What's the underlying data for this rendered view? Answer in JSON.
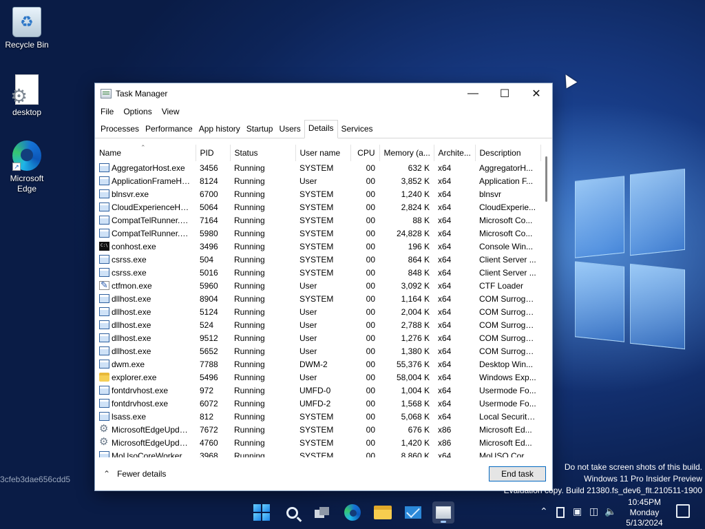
{
  "desktop": {
    "icons": [
      {
        "label": "Recycle Bin"
      },
      {
        "label": "desktop"
      },
      {
        "label": "Microsoft Edge"
      }
    ],
    "hash": "3cfeb3dae656cdd5",
    "watermark": [
      "Do not take screen shots of this build.",
      "Windows 11 Pro Insider Preview",
      "Evaluation copy. Build 21380.fs_dev6_flt.210511-1900"
    ]
  },
  "window": {
    "title": "Task Manager",
    "menu": [
      "File",
      "Options",
      "View"
    ],
    "tabs": [
      "Processes",
      "Performance",
      "App history",
      "Startup",
      "Users",
      "Details",
      "Services"
    ],
    "active_tab": "Details",
    "columns": [
      "Name",
      "PID",
      "Status",
      "User name",
      "CPU",
      "Memory (a...",
      "Archite...",
      "Description"
    ],
    "rows": [
      {
        "icon": "app",
        "name": "AggregatorHost.exe",
        "pid": "3456",
        "status": "Running",
        "user": "SYSTEM",
        "cpu": "00",
        "mem": "632 K",
        "arch": "x64",
        "desc": "AggregatorH..."
      },
      {
        "icon": "app",
        "name": "ApplicationFrameHo...",
        "pid": "8124",
        "status": "Running",
        "user": "User",
        "cpu": "00",
        "mem": "3,852 K",
        "arch": "x64",
        "desc": "Application F..."
      },
      {
        "icon": "app",
        "name": "blnsvr.exe",
        "pid": "6700",
        "status": "Running",
        "user": "SYSTEM",
        "cpu": "00",
        "mem": "1,240 K",
        "arch": "x64",
        "desc": "blnsvr"
      },
      {
        "icon": "app",
        "name": "CloudExperienceHos...",
        "pid": "5064",
        "status": "Running",
        "user": "SYSTEM",
        "cpu": "00",
        "mem": "2,824 K",
        "arch": "x64",
        "desc": "CloudExperie..."
      },
      {
        "icon": "app",
        "name": "CompatTelRunner.exe",
        "pid": "7164",
        "status": "Running",
        "user": "SYSTEM",
        "cpu": "00",
        "mem": "88 K",
        "arch": "x64",
        "desc": "Microsoft Co..."
      },
      {
        "icon": "app",
        "name": "CompatTelRunner.exe",
        "pid": "5980",
        "status": "Running",
        "user": "SYSTEM",
        "cpu": "00",
        "mem": "24,828 K",
        "arch": "x64",
        "desc": "Microsoft Co..."
      },
      {
        "icon": "console",
        "name": "conhost.exe",
        "pid": "3496",
        "status": "Running",
        "user": "SYSTEM",
        "cpu": "00",
        "mem": "196 K",
        "arch": "x64",
        "desc": "Console Win..."
      },
      {
        "icon": "app",
        "name": "csrss.exe",
        "pid": "504",
        "status": "Running",
        "user": "SYSTEM",
        "cpu": "00",
        "mem": "864 K",
        "arch": "x64",
        "desc": "Client Server ..."
      },
      {
        "icon": "app",
        "name": "csrss.exe",
        "pid": "5016",
        "status": "Running",
        "user": "SYSTEM",
        "cpu": "00",
        "mem": "848 K",
        "arch": "x64",
        "desc": "Client Server ..."
      },
      {
        "icon": "pen",
        "name": "ctfmon.exe",
        "pid": "5960",
        "status": "Running",
        "user": "User",
        "cpu": "00",
        "mem": "3,092 K",
        "arch": "x64",
        "desc": "CTF Loader"
      },
      {
        "icon": "app",
        "name": "dllhost.exe",
        "pid": "8904",
        "status": "Running",
        "user": "SYSTEM",
        "cpu": "00",
        "mem": "1,164 K",
        "arch": "x64",
        "desc": "COM Surrogate"
      },
      {
        "icon": "app",
        "name": "dllhost.exe",
        "pid": "5124",
        "status": "Running",
        "user": "User",
        "cpu": "00",
        "mem": "2,004 K",
        "arch": "x64",
        "desc": "COM Surrogate"
      },
      {
        "icon": "app",
        "name": "dllhost.exe",
        "pid": "524",
        "status": "Running",
        "user": "User",
        "cpu": "00",
        "mem": "2,788 K",
        "arch": "x64",
        "desc": "COM Surrogate"
      },
      {
        "icon": "app",
        "name": "dllhost.exe",
        "pid": "9512",
        "status": "Running",
        "user": "User",
        "cpu": "00",
        "mem": "1,276 K",
        "arch": "x64",
        "desc": "COM Surrogate"
      },
      {
        "icon": "app",
        "name": "dllhost.exe",
        "pid": "5652",
        "status": "Running",
        "user": "User",
        "cpu": "00",
        "mem": "1,380 K",
        "arch": "x64",
        "desc": "COM Surrogate"
      },
      {
        "icon": "app",
        "name": "dwm.exe",
        "pid": "7788",
        "status": "Running",
        "user": "DWM-2",
        "cpu": "00",
        "mem": "55,376 K",
        "arch": "x64",
        "desc": "Desktop Win..."
      },
      {
        "icon": "folder",
        "name": "explorer.exe",
        "pid": "5496",
        "status": "Running",
        "user": "User",
        "cpu": "00",
        "mem": "58,004 K",
        "arch": "x64",
        "desc": "Windows Exp..."
      },
      {
        "icon": "app",
        "name": "fontdrvhost.exe",
        "pid": "972",
        "status": "Running",
        "user": "UMFD-0",
        "cpu": "00",
        "mem": "1,004 K",
        "arch": "x64",
        "desc": "Usermode Fo..."
      },
      {
        "icon": "app",
        "name": "fontdrvhost.exe",
        "pid": "6072",
        "status": "Running",
        "user": "UMFD-2",
        "cpu": "00",
        "mem": "1,568 K",
        "arch": "x64",
        "desc": "Usermode Fo..."
      },
      {
        "icon": "app",
        "name": "lsass.exe",
        "pid": "812",
        "status": "Running",
        "user": "SYSTEM",
        "cpu": "00",
        "mem": "5,068 K",
        "arch": "x64",
        "desc": "Local Security..."
      },
      {
        "icon": "gear",
        "name": "MicrosoftEdgeUpdat...",
        "pid": "7672",
        "status": "Running",
        "user": "SYSTEM",
        "cpu": "00",
        "mem": "676 K",
        "arch": "x86",
        "desc": "Microsoft Ed..."
      },
      {
        "icon": "gear",
        "name": "MicrosoftEdgeUpdat...",
        "pid": "4760",
        "status": "Running",
        "user": "SYSTEM",
        "cpu": "00",
        "mem": "1,420 K",
        "arch": "x86",
        "desc": "Microsoft Ed..."
      },
      {
        "icon": "app",
        "name": "MoUsoCoreWorker.e...",
        "pid": "3968",
        "status": "Running",
        "user": "SYSTEM",
        "cpu": "00",
        "mem": "8,860 K",
        "arch": "x64",
        "desc": "MoUSO Core ..."
      }
    ],
    "fewer_details": "Fewer details",
    "end_task": "End task"
  },
  "taskbar": {
    "clock_time": "10:45PM",
    "clock_day": "Monday",
    "clock_date": "5/13/2024"
  }
}
